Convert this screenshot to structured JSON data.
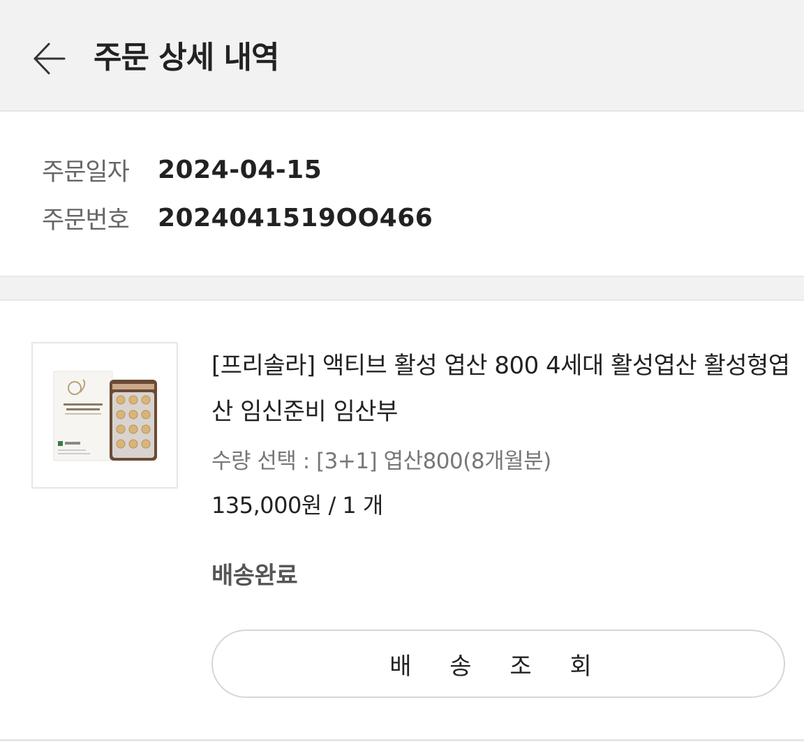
{
  "header": {
    "title": "주문 상세 내역",
    "back_icon": "arrow-left-icon"
  },
  "order": {
    "date_label": "주문일자",
    "date_value": "2024-04-15",
    "number_label": "주문번호",
    "number_value": "2024041519OO466"
  },
  "item": {
    "image_icon": "product-thumbnail",
    "name": "[프리솔라] 액티브 활성 엽산 800 4세대 활성엽산 활성형엽산 임신준비 임산부",
    "option": "수량 선택 : [3+1] 엽산800(8개월분)",
    "price": "135,000원 / 1 개",
    "status": "배송완료",
    "track_button": "배 송 조 회"
  },
  "colors": {
    "header_bg": "#f2f2f2",
    "text_primary": "#222222",
    "text_secondary": "#777777",
    "status": "#555555",
    "border": "#d6d6d6"
  }
}
